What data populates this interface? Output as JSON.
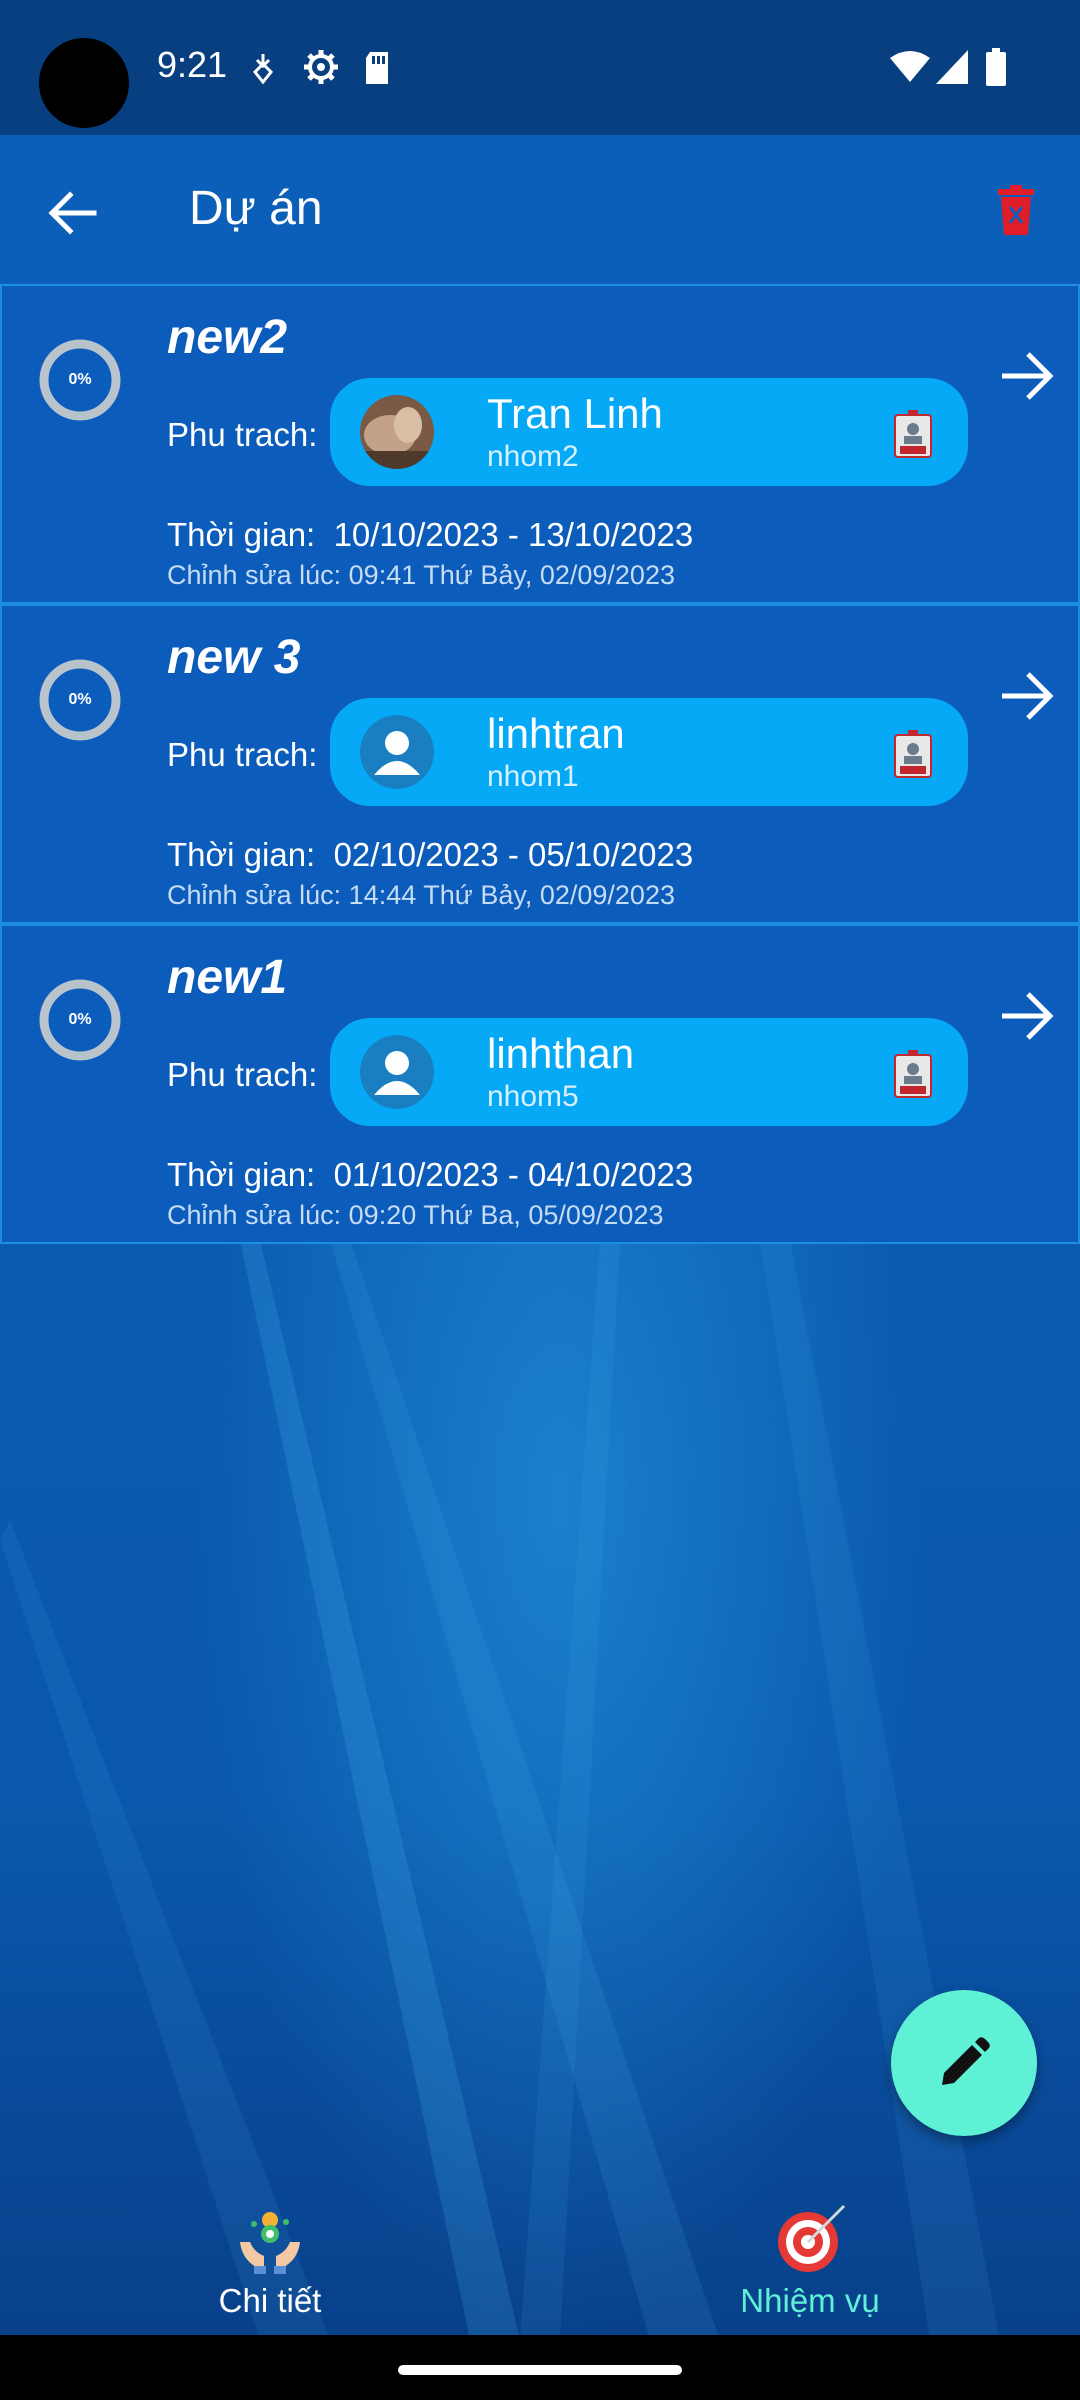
{
  "status_bar": {
    "time": "9:21"
  },
  "app_bar": {
    "title": "Dự án"
  },
  "projects": [
    {
      "progress_percent": 0,
      "progress_label": "0%",
      "name": "new2",
      "owner_label": "Phu trach:",
      "owner_name": "Tran Linh",
      "owner_group": "nhom2",
      "owner_avatar": "photo",
      "time_label": "Thời gian:",
      "date_range": "10/10/2023 - 13/10/2023",
      "edited": "Chỉnh sửa lúc: 09:41 Thứ Bảy, 02/09/2023"
    },
    {
      "progress_percent": 0,
      "progress_label": "0%",
      "name": "new 3",
      "owner_label": "Phu trach:",
      "owner_name": "linhtran",
      "owner_group": "nhom1",
      "owner_avatar": "default-person",
      "time_label": "Thời gian:",
      "date_range": "02/10/2023 - 05/10/2023",
      "edited": "Chỉnh sửa lúc: 14:44 Thứ Bảy, 02/09/2023"
    },
    {
      "progress_percent": 0,
      "progress_label": "0%",
      "name": "new1",
      "owner_label": "Phu trach:",
      "owner_name": "linhthan",
      "owner_group": "nhom5",
      "owner_avatar": "default-person",
      "time_label": "Thời gian:",
      "date_range": "01/10/2023 - 04/10/2023",
      "edited": "Chỉnh sửa lúc: 09:20 Thứ Ba, 05/09/2023"
    }
  ],
  "bottom_nav": {
    "items": [
      {
        "label": "Chi tiết",
        "icon": "hands-gear-icon",
        "color": "#ffffff"
      },
      {
        "label": "Nhiệm vụ",
        "icon": "target-icon",
        "color": "#5ff1d6",
        "active": true
      }
    ]
  },
  "colors": {
    "app_bar": "#0c5fb8",
    "card": "#0c5cbb",
    "chip": "#05a9f5",
    "fab": "#5ff1d6",
    "delete": "#e11d2a"
  }
}
